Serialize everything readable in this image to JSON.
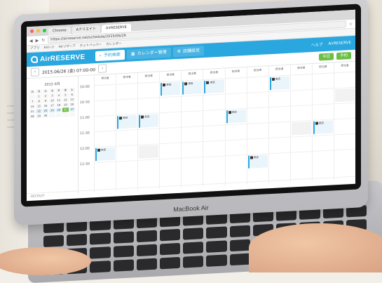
{
  "browser": {
    "tabs": [
      "Chrome",
      "Aクリエイト",
      "AirRESERVE"
    ],
    "url": "https://airreserve.net/schedule/2015/06/26",
    "bookmarks": [
      "アプリ",
      "Airレジ",
      "Airリザーブ",
      "ホットペッパー",
      "カレンダー"
    ]
  },
  "app": {
    "logo": "AirRESERVE",
    "nav": [
      {
        "label": "予約検索"
      },
      {
        "label": "カレンダー管理"
      },
      {
        "label": "店舗設定"
      }
    ],
    "right": [
      "ヘルプ",
      "AirRESERVE"
    ],
    "date_label": "2015.06/26 (金) 07:00-00",
    "actions": [
      "今日",
      "予約"
    ]
  },
  "mini_calendar": {
    "title": "2015 6月",
    "weekdays": [
      "日",
      "月",
      "火",
      "水",
      "木",
      "金",
      "土"
    ],
    "days": [
      "",
      "1",
      "2",
      "3",
      "4",
      "5",
      "6",
      "7",
      "8",
      "9",
      "10",
      "11",
      "12",
      "13",
      "14",
      "15",
      "16",
      "17",
      "18",
      "19",
      "20",
      "21",
      "22",
      "23",
      "24",
      "25",
      "26",
      "27",
      "28",
      "29",
      "30",
      "",
      "",
      "",
      ""
    ],
    "selected": "26"
  },
  "schedule": {
    "times": [
      "10:00",
      "10:30",
      "11:00",
      "11:30",
      "12:00",
      "12:30"
    ],
    "columns": [
      "担当者",
      "担当者",
      "担当者",
      "担当者",
      "担当者",
      "担当者",
      "担当者",
      "担当者",
      "担当者",
      "担当者",
      "担当者",
      "担当者"
    ],
    "bookings": [
      {
        "label": "来店"
      },
      {
        "label": "来店"
      },
      {
        "label": "来店"
      },
      {
        "label": "来店"
      },
      {
        "label": "来店"
      },
      {
        "label": "来店"
      },
      {
        "label": "来店"
      },
      {
        "label": "来店"
      },
      {
        "label": "来店"
      },
      {
        "label": "来店"
      }
    ]
  },
  "footer": "RECRUIT",
  "device": {
    "brand": "MacBook Air"
  }
}
